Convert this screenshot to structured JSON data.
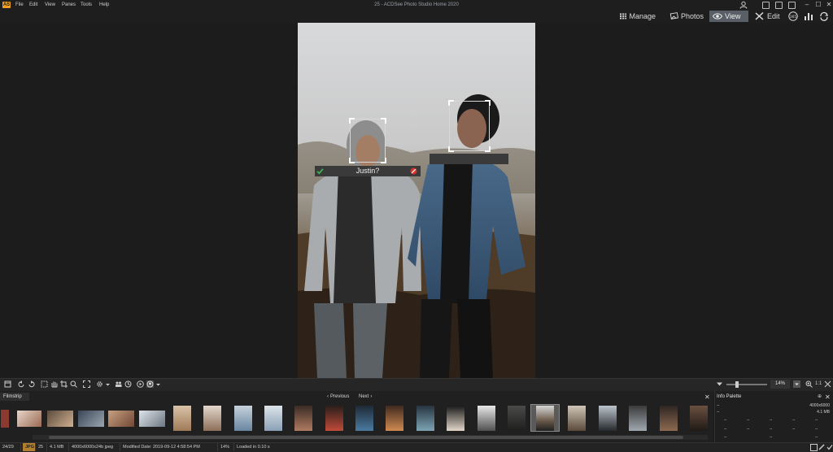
{
  "window": {
    "title": "25 - ACDSee Photo Studio Home 2020",
    "app_logo": "AS",
    "menu": [
      "File",
      "Edit",
      "View",
      "Panes",
      "Tools",
      "Help"
    ]
  },
  "modes": [
    {
      "label": "Manage",
      "icon": "grid-icon"
    },
    {
      "label": "Photos",
      "icon": "photos-icon"
    },
    {
      "label": "View",
      "icon": "eye-icon",
      "active": true
    },
    {
      "label": "Edit",
      "icon": "edit-tools-icon"
    }
  ],
  "face_tags": [
    {
      "label": "Justin?"
    },
    {
      "label": ""
    }
  ],
  "filmstrip": {
    "tab_label": "Filmstrip",
    "previous_label": "Previous",
    "next_label": "Next",
    "selected_index": 17,
    "thumbnail_count": 24
  },
  "zoom": {
    "value": "14%",
    "ratio_label": "1:1",
    "level": 0.14
  },
  "info_palette": {
    "title": "Info Palette",
    "rows": [
      {
        "left": "--",
        "right": "4000x6000"
      },
      {
        "left": "--",
        "right": "4.1 MB"
      }
    ],
    "grid": [
      "--",
      "--",
      "--",
      "--",
      "--",
      "--",
      "--",
      "--",
      "--",
      "--",
      "--",
      "--",
      "--"
    ]
  },
  "status": {
    "position": "24/29",
    "format": "JPG",
    "name": "25",
    "size": "4.1 MB",
    "dimensions": "4000x6000x24b jpeg",
    "modified": "Modified Date: 2019-09-12 4:58:54 PM",
    "zoom": "14%",
    "loaded": "Loaded in 0.10 s"
  },
  "colors": {
    "background": "#1b1b1b",
    "active_tab": "#5a5f67",
    "accept": "#3fb34f",
    "reject": "#d9322c",
    "accent": "#f0a020"
  }
}
